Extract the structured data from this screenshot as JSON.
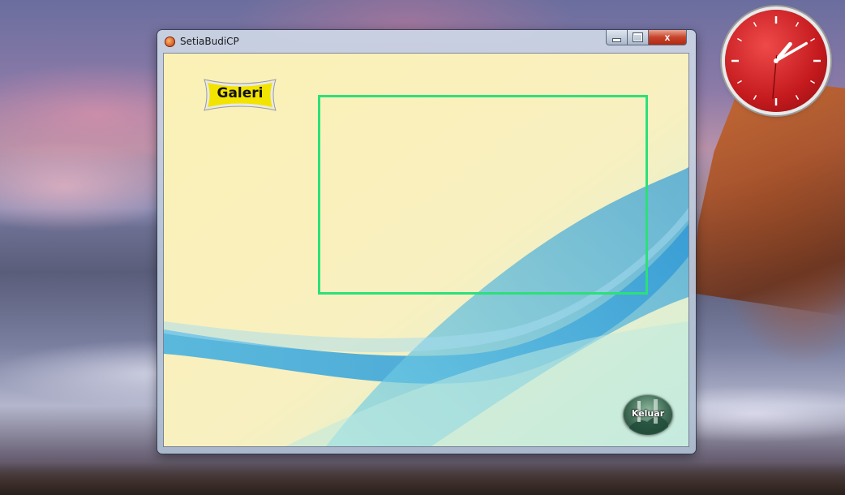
{
  "window": {
    "title": "SetiaBudiCP",
    "caption_buttons": {
      "minimize_icon": "minimize-icon",
      "maximize_icon": "maximize-icon",
      "close_icon": "close-icon",
      "close_glyph": "x"
    }
  },
  "content": {
    "gallery_badge": "Galeri",
    "exit_button": "Keluar"
  },
  "desktop": {
    "gadget": "analog-clock",
    "clock_hour_hand_deg": 40,
    "clock_minute_hand_deg": 60,
    "clock_second_hand_deg": 185
  },
  "colors": {
    "frame_border": "#2ce07a",
    "client_background": "#fbf1b6",
    "clock_face": "#c41a1e",
    "badge_yellow": "#f2e300"
  }
}
